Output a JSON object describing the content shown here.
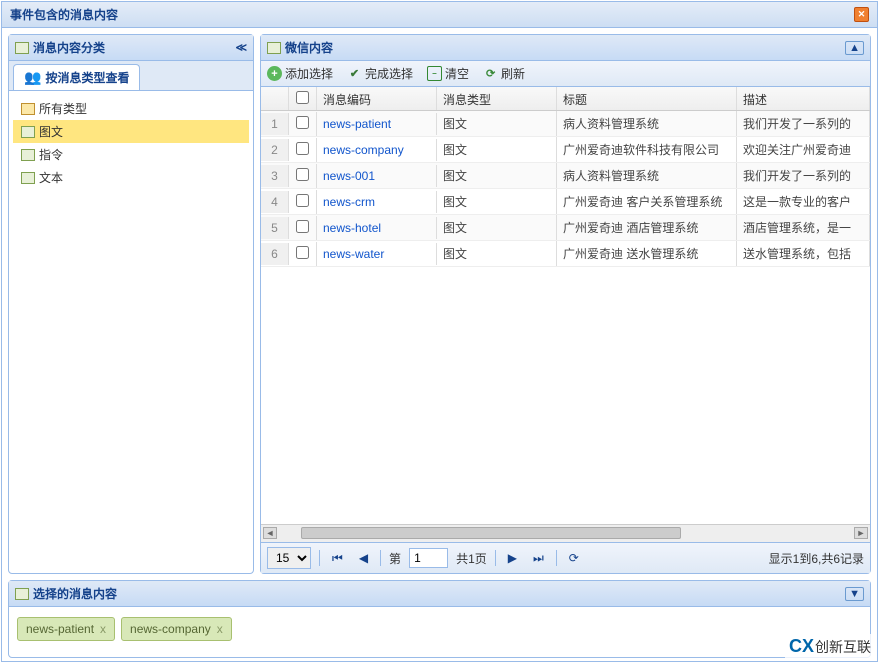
{
  "window": {
    "title": "事件包含的消息内容"
  },
  "sidebar": {
    "header": "消息内容分类",
    "tab": "按消息类型查看",
    "items": [
      {
        "label": "所有类型",
        "selected": false,
        "iconKind": "folder"
      },
      {
        "label": "图文",
        "selected": true,
        "iconKind": "doc"
      },
      {
        "label": "指令",
        "selected": false,
        "iconKind": "doc"
      },
      {
        "label": "文本",
        "selected": false,
        "iconKind": "doc"
      }
    ]
  },
  "content": {
    "header": "微信内容",
    "toolbar": {
      "add": "添加选择",
      "finish": "完成选择",
      "clear": "清空",
      "refresh": "刷新"
    },
    "columns": {
      "code": "消息编码",
      "type": "消息类型",
      "title": "标题",
      "desc": "描述"
    },
    "rows": [
      {
        "n": "1",
        "code": "news-patient",
        "type": "图文",
        "title": "病人资料管理系统",
        "desc": "我们开发了一系列的"
      },
      {
        "n": "2",
        "code": "news-company",
        "type": "图文",
        "title": "广州爱奇迪软件科技有限公司",
        "desc": "欢迎关注广州爱奇迪"
      },
      {
        "n": "3",
        "code": "news-001",
        "type": "图文",
        "title": "病人资料管理系统",
        "desc": "我们开发了一系列的"
      },
      {
        "n": "4",
        "code": "news-crm",
        "type": "图文",
        "title": "广州爱奇迪 客户关系管理系统",
        "desc": "这是一款专业的客户"
      },
      {
        "n": "5",
        "code": "news-hotel",
        "type": "图文",
        "title": "广州爱奇迪 酒店管理系统",
        "desc": "酒店管理系统，是一"
      },
      {
        "n": "6",
        "code": "news-water",
        "type": "图文",
        "title": "广州爱奇迪 送水管理系统",
        "desc": "送水管理系统，包括"
      }
    ],
    "pager": {
      "pageSize": "15",
      "pageLabelPrefix": "第",
      "page": "1",
      "totalPages": "共1页",
      "summary": "显示1到6,共6记录"
    }
  },
  "selected": {
    "header": "选择的消息内容",
    "tags": [
      "news-patient",
      "news-company"
    ]
  },
  "watermark": {
    "logo": "CX",
    "text": "创新互联"
  }
}
